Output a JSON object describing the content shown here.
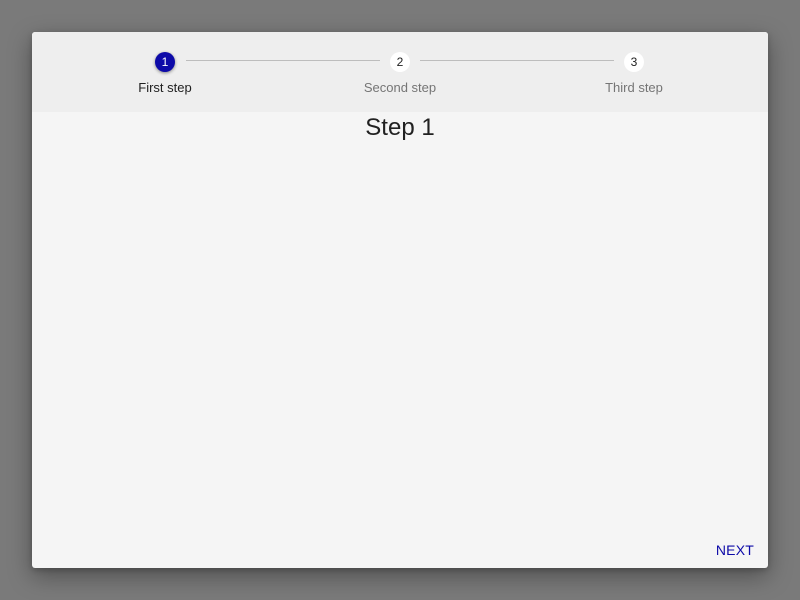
{
  "stepper": {
    "steps": [
      {
        "number": "1",
        "label": "First step",
        "state": "active"
      },
      {
        "number": "2",
        "label": "Second step",
        "state": "inactive"
      },
      {
        "number": "3",
        "label": "Third step",
        "state": "inactive"
      }
    ]
  },
  "content": {
    "title": "Step 1"
  },
  "actions": {
    "next_label": "NEXT"
  },
  "colors": {
    "accent": "#0d0aa8",
    "backdrop": "#7a7a7a",
    "card": "#f5f5f5",
    "stepper_bg": "#eeeeee"
  }
}
